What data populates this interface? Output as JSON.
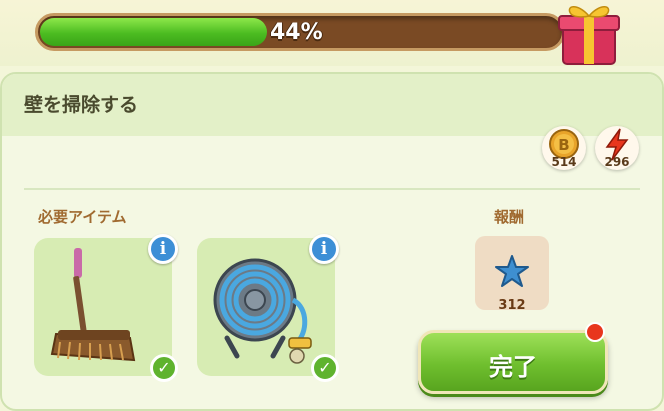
{
  "progress": {
    "percent_text": "44%",
    "fraction": 0.44
  },
  "task": {
    "title": "壁を掃除する"
  },
  "currencies": [
    {
      "icon": "coin-icon",
      "value": "514"
    },
    {
      "icon": "energy-bolt-icon",
      "value": "296"
    }
  ],
  "required": {
    "label": "必要アイテム",
    "items": [
      {
        "icon": "broom-icon",
        "status": "owned"
      },
      {
        "icon": "hose-reel-icon",
        "status": "owned"
      }
    ]
  },
  "reward": {
    "label": "報酬",
    "icon": "star-icon",
    "value": "312"
  },
  "actions": {
    "complete_label": "完了"
  },
  "colors": {
    "progress_fill": "#4cbc21",
    "progress_track": "#7a4a24",
    "button_green": "#6fbf2e",
    "notify_red": "#e8361d",
    "info_blue": "#3d8fd6"
  }
}
